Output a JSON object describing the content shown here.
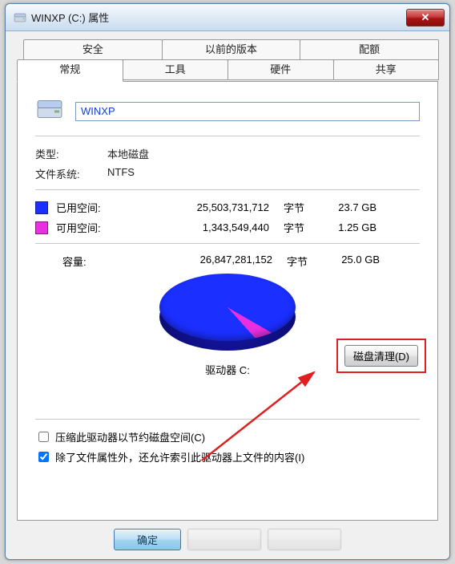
{
  "title": "WINXP (C:) 属性",
  "tabs_row1": [
    "安全",
    "以前的版本",
    "配额"
  ],
  "tabs_row2": [
    "常规",
    "工具",
    "硬件",
    "共享"
  ],
  "active_tab": "常规",
  "drive_name": "WINXP",
  "type_label": "类型:",
  "type_value": "本地磁盘",
  "fs_label": "文件系统:",
  "fs_value": "NTFS",
  "used": {
    "label": "已用空间:",
    "bytes": "25,503,731,712",
    "unit": "字节",
    "size": "23.7 GB",
    "color": "#1b2fff"
  },
  "free": {
    "label": "可用空间:",
    "bytes": "1,343,549,440",
    "unit": "字节",
    "size": "1.25 GB",
    "color": "#e830e0"
  },
  "capacity": {
    "label": "容量:",
    "bytes": "26,847,281,152",
    "unit": "字节",
    "size": "25.0 GB"
  },
  "drive_label": "驱动器 C:",
  "cleanup_button": "磁盘清理(D)",
  "cb_compress": "压缩此驱动器以节约磁盘空间(C)",
  "cb_index": "除了文件属性外，还允许索引此驱动器上文件的内容(I)",
  "cb_compress_checked": false,
  "cb_index_checked": true,
  "btn_ok": "确定",
  "chart_data": {
    "type": "pie",
    "title": "驱动器 C:",
    "series": [
      {
        "name": "已用空间",
        "value": 25503731712,
        "color": "#1b2fff"
      },
      {
        "name": "可用空间",
        "value": 1343549440,
        "color": "#e830e0"
      }
    ],
    "total": 26847281152,
    "display_unit": "字节"
  }
}
